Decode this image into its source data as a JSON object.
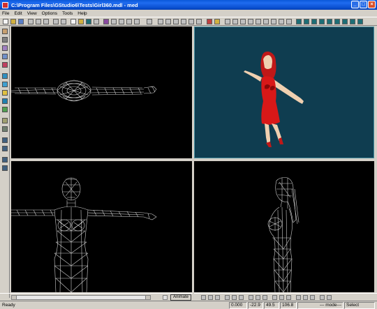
{
  "window": {
    "title": "C:\\Program Files\\GStudio6\\Tests\\Girl360.mdl - med",
    "minimize": "_",
    "maximize": "□",
    "close": "×"
  },
  "menu": [
    "File",
    "Edit",
    "View",
    "Options",
    "Tools",
    "Help"
  ],
  "bottom": {
    "animate_label": "Animate"
  },
  "status": {
    "ready": "Ready",
    "coord_1": "0.000",
    "coord_2": "-22.9",
    "coord_3": "49.5",
    "coord_4": "106.8",
    "mode": "--- mode---",
    "select": "Select"
  },
  "colors": {
    "viewport_bg": "#000000",
    "shaded_viewport_bg": "#0f3d50",
    "model_red": "#d81818",
    "skin": "#f0d8b8",
    "hair": "#c01818",
    "titlebar": "#0a58d8"
  }
}
